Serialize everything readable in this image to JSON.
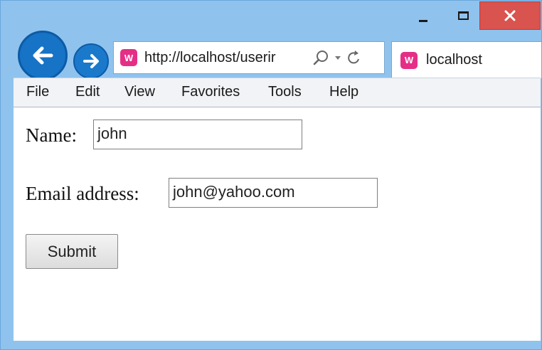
{
  "window": {
    "controls": {
      "minimize": "minimize",
      "maximize": "maximize",
      "close": "close"
    }
  },
  "browser": {
    "address": {
      "url": "http://localhost/userir"
    },
    "tab": {
      "title": "localhost"
    }
  },
  "menu": {
    "items": [
      "File",
      "Edit",
      "View",
      "Favorites",
      "Tools",
      "Help"
    ]
  },
  "form": {
    "name_label": "Name:",
    "name_value": "john",
    "email_label": "Email address:",
    "email_value": "john@yahoo.com",
    "submit_label": "Submit"
  },
  "colors": {
    "frame": "#8fc3ee",
    "close_button": "#d9534f",
    "nav_button": "#1673c6",
    "site_icon": "#e52f87"
  },
  "icons": [
    "back-arrow-icon",
    "forward-arrow-icon",
    "site-favicon-icon",
    "search-icon",
    "dropdown-icon",
    "refresh-icon",
    "minimize-icon",
    "maximize-icon",
    "close-icon"
  ]
}
